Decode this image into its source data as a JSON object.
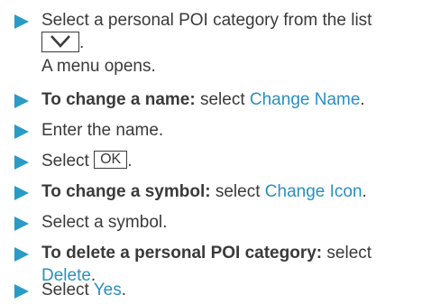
{
  "steps": [
    {
      "line1": "Select a personal POI category from the list",
      "line2_suffix": ".",
      "line3": "A menu opens.",
      "icon": "chevron-down-icon"
    },
    {
      "bold": "To change a name:",
      "pre": " select ",
      "link": "Change Name",
      "post": "."
    },
    {
      "text": "Enter the name."
    },
    {
      "pre": "Select ",
      "key": "OK",
      "post": "."
    },
    {
      "bold": "To change a symbol:",
      "pre": " select ",
      "link": "Change Icon",
      "post": "."
    },
    {
      "text": "Select a symbol."
    },
    {
      "bold": "To delete a personal POI category:",
      "pre": " select",
      "link": "Delete",
      "post": "."
    },
    {
      "pre": "Select ",
      "link": "Yes",
      "post": "."
    }
  ],
  "colors": {
    "arrow": "#2a9bc4",
    "link": "#2a8fc0",
    "text": "#3a3a3a"
  }
}
